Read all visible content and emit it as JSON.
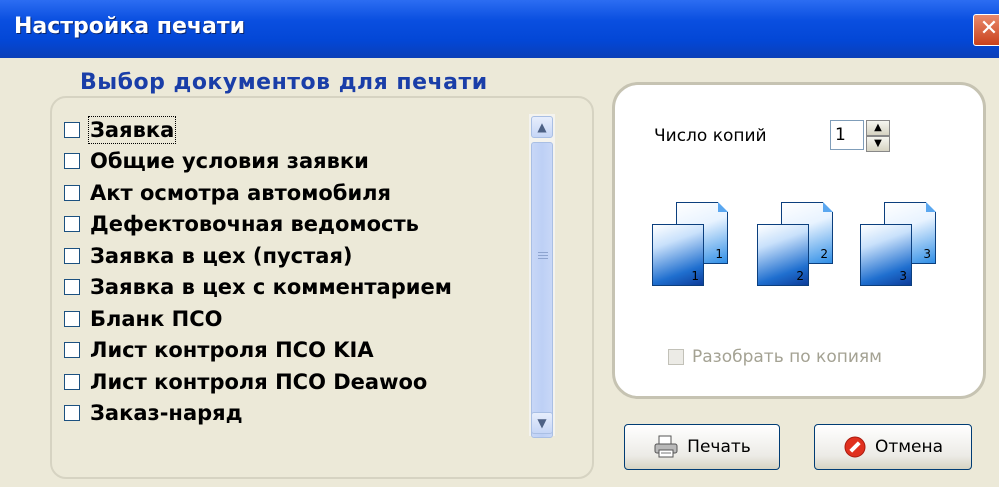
{
  "window": {
    "title": "Настройка печати",
    "close_glyph": "✕"
  },
  "documents": {
    "title": "Выбор документов для печати",
    "items": [
      {
        "label": "Заявка",
        "checked": false
      },
      {
        "label": "Общие условия заявки",
        "checked": false
      },
      {
        "label": "Акт осмотра автомобиля",
        "checked": false
      },
      {
        "label": "Дефектовочная ведомость",
        "checked": false
      },
      {
        "label": "Заявка в цех (пустая)",
        "checked": false
      },
      {
        "label": "Заявка в цех с комментарием",
        "checked": false
      },
      {
        "label": "Бланк ПСО",
        "checked": false
      },
      {
        "label": "Лист контроля ПСО KIA",
        "checked": false
      },
      {
        "label": "Лист контроля ПСО Deawoo",
        "checked": false
      },
      {
        "label": "Заказ-наряд",
        "checked": false
      }
    ]
  },
  "copies": {
    "label": "Число копий",
    "value": "1",
    "page_numbers": [
      "1",
      "2",
      "3"
    ],
    "collate_label": "Разобрать по копиям",
    "collate_enabled": false
  },
  "buttons": {
    "print": "Печать",
    "cancel": "Отмена"
  },
  "colors": {
    "titlebar": "#0347d6",
    "group_title": "#1a3ea8",
    "dialog_bg": "#ece9d8",
    "disabled_text": "#a4a293"
  }
}
